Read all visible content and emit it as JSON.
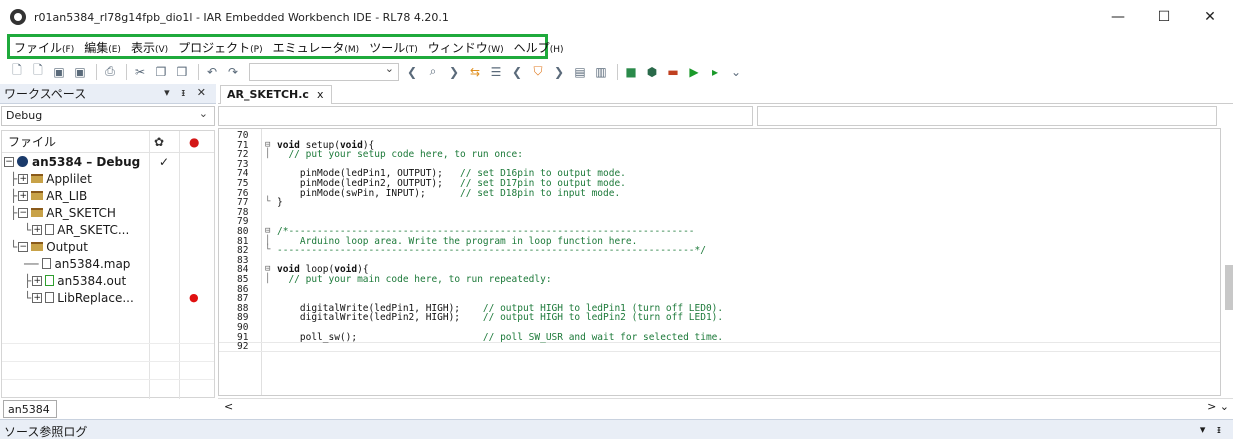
{
  "window": {
    "title": "r01an5384_rl78g14fpb_dio1l - IAR Embedded Workbench IDE - RL78 4.20.1",
    "minimize": "—",
    "maximize": "☐",
    "close": "✕"
  },
  "menu": {
    "highlight_color": "#1faa3c",
    "items": [
      {
        "label": "ファイル",
        "key": "(F)"
      },
      {
        "label": "編集",
        "key": "(E)"
      },
      {
        "label": "表示",
        "key": "(V)"
      },
      {
        "label": "プロジェクト",
        "key": "(P)"
      },
      {
        "label": "エミュレータ",
        "key": "(M)"
      },
      {
        "label": "ツール",
        "key": "(T)"
      },
      {
        "label": "ウィンドウ",
        "key": "(W)"
      },
      {
        "label": "ヘルプ",
        "key": "(H)"
      }
    ]
  },
  "workspace": {
    "title": "ワークスペース",
    "controls": "▾ ᵻ ✕",
    "config": "Debug",
    "column_files": "ファイル",
    "tab": "an5384",
    "tree": {
      "project": "an5384 – Debug",
      "project_check": "✓",
      "applilet": "Applilet",
      "ar_lib": "AR_LIB",
      "ar_sketch": "AR_SKETCH",
      "ar_sketch_file": "AR_SKETC...",
      "output": "Output",
      "map_file": "an5384.map",
      "out_file": "an5384.out",
      "lib_replace": "LibReplace..."
    }
  },
  "editor": {
    "tab_label": "AR_SKETCH.c",
    "tab_close": "x",
    "scroll_left": "<",
    "scroll_right": "> ⌄",
    "lines": [
      {
        "n": "70",
        "fold": "",
        "code": ""
      },
      {
        "n": "71",
        "fold": "⊟",
        "code": "void setup(void){"
      },
      {
        "n": "72",
        "fold": "│",
        "code": "  // put your setup code here, to run once:"
      },
      {
        "n": "73",
        "fold": "",
        "code": ""
      },
      {
        "n": "74",
        "fold": "",
        "code": "    pinMode(ledPin1, OUTPUT);   // set D16pin to output mode."
      },
      {
        "n": "75",
        "fold": "",
        "code": "    pinMode(ledPin2, OUTPUT);   // set D17pin to output mode."
      },
      {
        "n": "76",
        "fold": "",
        "code": "    pinMode(swPin, INPUT);      // set D18pin to input mode."
      },
      {
        "n": "77",
        "fold": "└",
        "code": "}"
      },
      {
        "n": "78",
        "fold": "",
        "code": ""
      },
      {
        "n": "79",
        "fold": "",
        "code": ""
      },
      {
        "n": "80",
        "fold": "⊟",
        "code": "/*-----------------------------------------------------------------------"
      },
      {
        "n": "81",
        "fold": "│",
        "code": "    Arduino loop area. Write the program in loop function here."
      },
      {
        "n": "82",
        "fold": "└",
        "code": "-------------------------------------------------------------------------*/"
      },
      {
        "n": "83",
        "fold": "",
        "code": ""
      },
      {
        "n": "84",
        "fold": "⊟",
        "code": "void loop(void){"
      },
      {
        "n": "85",
        "fold": "│",
        "code": "  // put your main code here, to run repeatedly:"
      },
      {
        "n": "86",
        "fold": "",
        "code": ""
      },
      {
        "n": "87",
        "fold": "",
        "code": ""
      },
      {
        "n": "88",
        "fold": "",
        "code": "    digitalWrite(ledPin1, HIGH);    // output HIGH to ledPin1 (turn off LED0)."
      },
      {
        "n": "89",
        "fold": "",
        "code": "    digitalWrite(ledPin2, HIGH);    // output HIGH to ledPin2 (turn off LED1)."
      },
      {
        "n": "90",
        "fold": "",
        "code": ""
      },
      {
        "n": "91",
        "fold": "",
        "code": "    poll_sw();                      // poll SW_USR and wait for selected time."
      },
      {
        "n": "92",
        "fold": "",
        "code": ""
      }
    ]
  },
  "statusbar": {
    "label": "ソース参照ログ",
    "controls": "▾ ᵻ"
  }
}
